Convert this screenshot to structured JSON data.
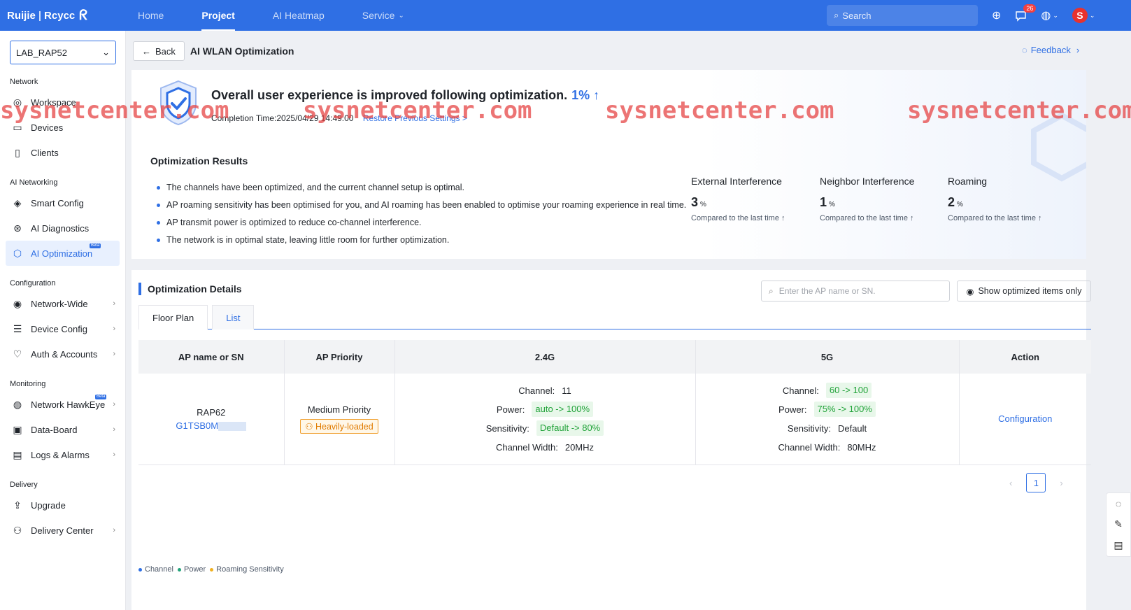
{
  "brand": {
    "name": "Ruijie",
    "sep": "|",
    "sub": "Rcycc"
  },
  "nav": {
    "home": "Home",
    "project": "Project",
    "heatmap": "AI Heatmap",
    "service": "Service"
  },
  "top": {
    "search_placeholder": "Search",
    "notif_count": "26",
    "avatar_letter": "S"
  },
  "sidebar": {
    "project": "LAB_RAP52",
    "sections": {
      "network": "Network",
      "ai_networking": "AI Networking",
      "configuration": "Configuration",
      "monitoring": "Monitoring",
      "delivery": "Delivery"
    },
    "items": {
      "workspace": "Workspace",
      "devices": "Devices",
      "clients": "Clients",
      "smart_config": "Smart Config",
      "ai_diagnostics": "AI Diagnostics",
      "ai_optimization": "AI Optimization",
      "network_wide": "Network-Wide",
      "device_config": "Device Config",
      "auth_accounts": "Auth & Accounts",
      "network_hawkeye": "Network HawkEye",
      "data_board": "Data-Board",
      "logs_alarms": "Logs & Alarms",
      "upgrade": "Upgrade",
      "delivery_center": "Delivery Center"
    },
    "beta": "Beta"
  },
  "page": {
    "back": "Back",
    "title": "AI WLAN Optimization",
    "feedback": "Feedback"
  },
  "summary": {
    "headline": "Overall user experience is improved following optimization.",
    "improvement": "1% ↑",
    "completion": "Completion Time:2025/04/29 14:49:00",
    "restore": "Restore Previous Settings >",
    "results_title": "Optimization Results",
    "results": [
      "The channels have been optimized, and the current channel setup is optimal.",
      "AP roaming sensitivity has been optimised for you, and AI roaming has been enabled to optimise your roaming experience in real time.",
      "AP transmit power is optimized to reduce co-channel interference.",
      "The network is in optimal state, leaving little room for further optimization."
    ],
    "metrics": [
      {
        "label": "External Interference",
        "value": "3",
        "unit": "%",
        "compare": "Compared to the last time ↑"
      },
      {
        "label": "Neighbor Interference",
        "value": "1",
        "unit": "%",
        "compare": "Compared to the last time ↑"
      },
      {
        "label": "Roaming",
        "value": "2",
        "unit": "%",
        "compare": "Compared to the last time ↑"
      }
    ]
  },
  "details": {
    "title": "Optimization Details",
    "search_placeholder": "Enter the AP name or SN.",
    "show_optimized": "Show optimized items only",
    "tabs": [
      "Floor Plan",
      "List"
    ],
    "columns": [
      "AP name or SN",
      "AP Priority",
      "2.4G",
      "5G",
      "Action"
    ],
    "row": {
      "name": "RAP62",
      "sn": "G1TSB0M",
      "priority": "Medium Priority",
      "load": "Heavily-loaded",
      "g24": {
        "channel_label": "Channel:",
        "channel": "11",
        "power_label": "Power:",
        "power": "auto -> 100%",
        "sens_label": "Sensitivity:",
        "sens": "Default -> 80%",
        "width_label": "Channel Width:",
        "width": "20MHz"
      },
      "g5": {
        "channel_label": "Channel:",
        "channel": "60 -> 100",
        "power_label": "Power:",
        "power": "75% -> 100%",
        "sens_label": "Sensitivity:",
        "sens": "Default",
        "width_label": "Channel Width:",
        "width": "80MHz"
      },
      "action": "Configuration"
    },
    "page": "1",
    "legend": [
      "Channel",
      "Power",
      "Roaming Sensitivity"
    ]
  },
  "watermark": "sysnetcenter.com",
  "colors": {
    "primary": "#2f6fe4",
    "success": "#22a33a",
    "warning": "#e07b00",
    "watermark": "#e64646"
  }
}
